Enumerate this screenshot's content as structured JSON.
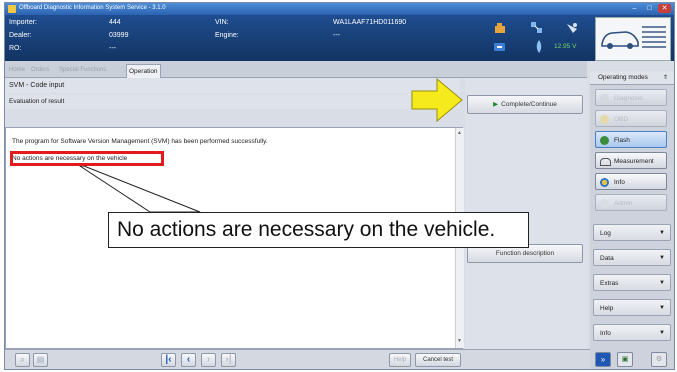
{
  "window": {
    "title": "Offboard Diagnostic Information System Service - 3.1.0",
    "buttons": [
      "–",
      "□",
      "✕"
    ]
  },
  "vehicle_info": {
    "importer_label": "Importer:",
    "importer_value": "444",
    "dealer_label": "Dealer:",
    "dealer_value": "03999",
    "ro_label": "RO:",
    "ro_value": "---",
    "vin_label": "VIN:",
    "vin_value": "WA1LAAF71HD011690",
    "engine_label": "Engine:",
    "engine_value": "---",
    "voltage": "12.95 V"
  },
  "tabs": [
    {
      "label": "Home",
      "active": false
    },
    {
      "label": "Orders",
      "active": false
    },
    {
      "label": "Special Functions",
      "active": false
    },
    {
      "label": "Operation",
      "active": true
    }
  ],
  "main": {
    "header_title": "SVM - Code input",
    "header_sub": "Evaluation of result",
    "line1": "The program for Software Version Management (SVM) has been performed successfully.",
    "line2": "No actions are necessary on the vehicle",
    "complete_button": "Complete/Continue",
    "function_description_button": "Function description"
  },
  "sidebar": {
    "operating_modes_label": "Operating modes",
    "modes": [
      {
        "label": "Diagnosis",
        "state": "disabled",
        "icon": "diagnosis-icon"
      },
      {
        "label": "OBD",
        "state": "disabled",
        "icon": "obd-icon"
      },
      {
        "label": "Flash",
        "state": "selected",
        "icon": "flash-icon"
      },
      {
        "label": "Measurement",
        "state": "enabled",
        "icon": "measurement-icon"
      },
      {
        "label": "Info",
        "state": "enabled",
        "icon": "info-icon"
      },
      {
        "label": "Admin",
        "state": "disabled",
        "icon": "admin-icon"
      }
    ],
    "sections": [
      "Log",
      "Data",
      "Extras",
      "Help",
      "Info"
    ]
  },
  "bottom": {
    "help_label": "Help",
    "cancel_test_label": "Cancel test"
  },
  "callout": {
    "text": "No actions are necessary on the vehicle."
  },
  "colors": {
    "header_blue": "#1f4d8f",
    "highlight_red": "#e21c1c",
    "arrow_yellow": "#f5ea1c",
    "selected_blue": "#a9c7ee"
  }
}
